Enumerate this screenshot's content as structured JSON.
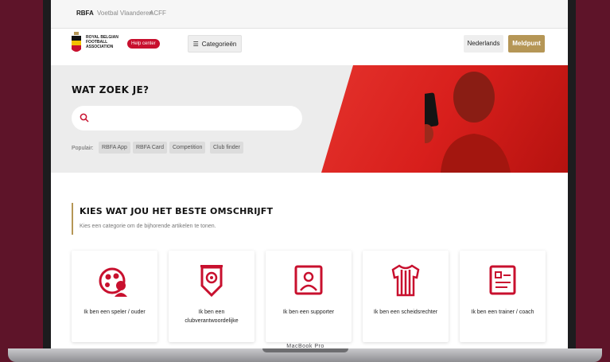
{
  "org_bar": {
    "items": [
      "RBFA",
      "Voetbal Vlaanderen",
      "ACFF"
    ]
  },
  "header": {
    "logo_lines": [
      "ROYAL BELGIAN",
      "FOOTBALL",
      "ASSOCIATION"
    ],
    "help_center": "Help center",
    "categories_label": "Categorieën",
    "language_label": "Nederlands",
    "report_label": "Meldpunt"
  },
  "hero": {
    "title": "WAT ZOEK JE?",
    "search_placeholder": "",
    "popular_label": "Populair:",
    "tags": [
      "RBFA App",
      "RBFA Card",
      "Competition",
      "Club finder"
    ]
  },
  "section": {
    "title": "KIES WAT JOU HET BESTE OMSCHRIJFT",
    "subtitle": "Kies een categorie om de bijhorende artikelen te tonen."
  },
  "cards": [
    {
      "label": "Ik ben een speler / ouder",
      "icon": "player-parent-icon"
    },
    {
      "label": "Ik ben een clubverantwoordelijke",
      "icon": "club-pennant-icon"
    },
    {
      "label": "Ik ben een supporter",
      "icon": "supporter-icon"
    },
    {
      "label": "Ik ben een scheidsrechter",
      "icon": "referee-shirt-icon"
    },
    {
      "label": "Ik ben een trainer / coach",
      "icon": "trainer-board-icon"
    }
  ],
  "device": {
    "label": "MacBook Pro"
  },
  "colors": {
    "brand_red": "#c8102e",
    "gold": "#b59656",
    "background": "#5e1429"
  }
}
